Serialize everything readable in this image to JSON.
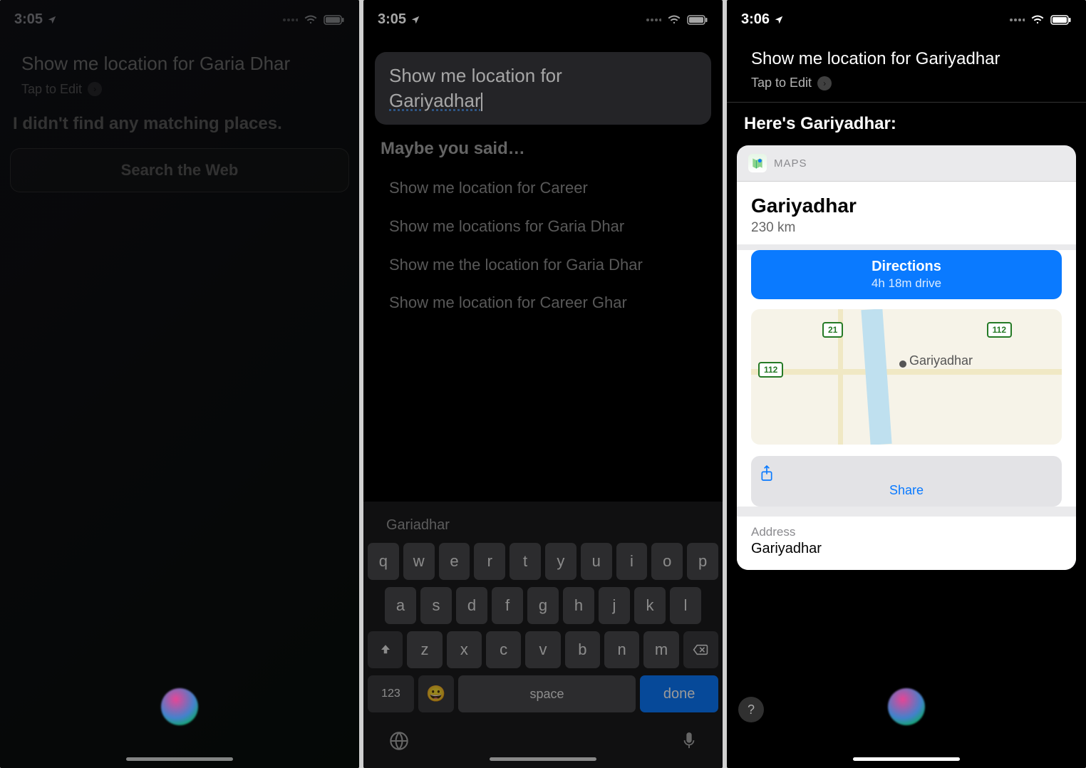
{
  "panel1": {
    "status": {
      "time": "3:05"
    },
    "query": "Show me location for Garia Dhar",
    "tap_to_edit": "Tap to Edit",
    "response": "I didn't find any matching places.",
    "search_web": "Search the Web"
  },
  "panel2": {
    "status": {
      "time": "3:05"
    },
    "edit_text_line1": "Show me location for",
    "edit_text_line2": "Gariyadhar",
    "maybe_label": "Maybe you said…",
    "suggestions": [
      "Show me location for Career",
      "Show me locations for Garia Dhar",
      "Show me the location for Garia Dhar",
      "Show me location for Career Ghar"
    ],
    "autocomplete": "Gariadhar",
    "keyboard": {
      "row1": [
        "q",
        "w",
        "e",
        "r",
        "t",
        "y",
        "u",
        "i",
        "o",
        "p"
      ],
      "row2": [
        "a",
        "s",
        "d",
        "f",
        "g",
        "h",
        "j",
        "k",
        "l"
      ],
      "row3": [
        "z",
        "x",
        "c",
        "v",
        "b",
        "n",
        "m"
      ],
      "key123": "123",
      "space": "space",
      "done": "done"
    }
  },
  "panel3": {
    "status": {
      "time": "3:06"
    },
    "query": "Show me location for Gariyadhar",
    "tap_to_edit": "Tap to Edit",
    "result_heading": "Here's Gariyadhar:",
    "maps_label": "MAPS",
    "place_title": "Gariyadhar",
    "place_distance": "230 km",
    "directions_label": "Directions",
    "drive_time": "4h 18m drive",
    "map_shields": [
      "21",
      "112",
      "112"
    ],
    "map_city": "Gariyadhar",
    "share_label": "Share",
    "address_label": "Address",
    "address_value": "Gariyadhar",
    "help": "?"
  }
}
